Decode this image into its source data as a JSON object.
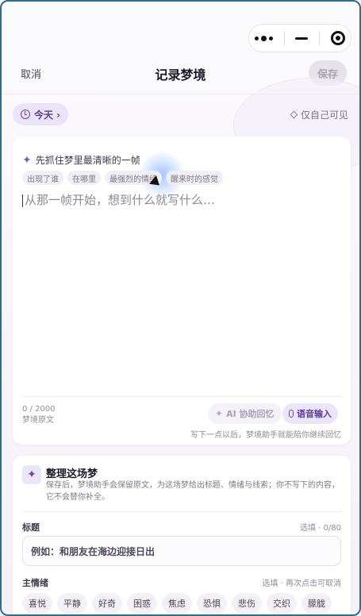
{
  "capsule": {
    "more_icon": "more-dots-icon",
    "minimize_icon": "minimize-icon",
    "close_icon": "target-icon"
  },
  "nav": {
    "cancel": "取消",
    "title": "记录梦境",
    "save": "保存"
  },
  "date": {
    "label": "今天 ›"
  },
  "privacy": {
    "label": "仅自己可见"
  },
  "editor": {
    "prompt": "先抓住梦里最清晰的一帧",
    "tags": [
      "出现了谁",
      "在哪里",
      "最强烈的情绪",
      "醒来时的感觉"
    ],
    "placeholder": "从那一帧开始，想到什么就写什么…",
    "count": "0 / 2000",
    "count_caption": "梦境原文",
    "ai_button": "AI 协助回忆",
    "voice_button": "语音输入",
    "hint": "写下一点以后，梦境助手就能陪你继续回忆"
  },
  "organize": {
    "title": "整理这场梦",
    "description": "保存后，梦境助手会保留原文，为这场梦给出标题、情绪与线索；你不写下的内容，它不会替你补全。",
    "title_label": "标题",
    "title_count": "选填 · 0/80",
    "title_placeholder": "例如：和朋友在海边迎接日出",
    "mood_label": "主情绪",
    "mood_hint": "选填 · 再次点击可取消",
    "moods": [
      "喜悦",
      "平静",
      "好奇",
      "困惑",
      "焦虑",
      "恐惧",
      "悲伤",
      "交织",
      "朦胧"
    ]
  }
}
